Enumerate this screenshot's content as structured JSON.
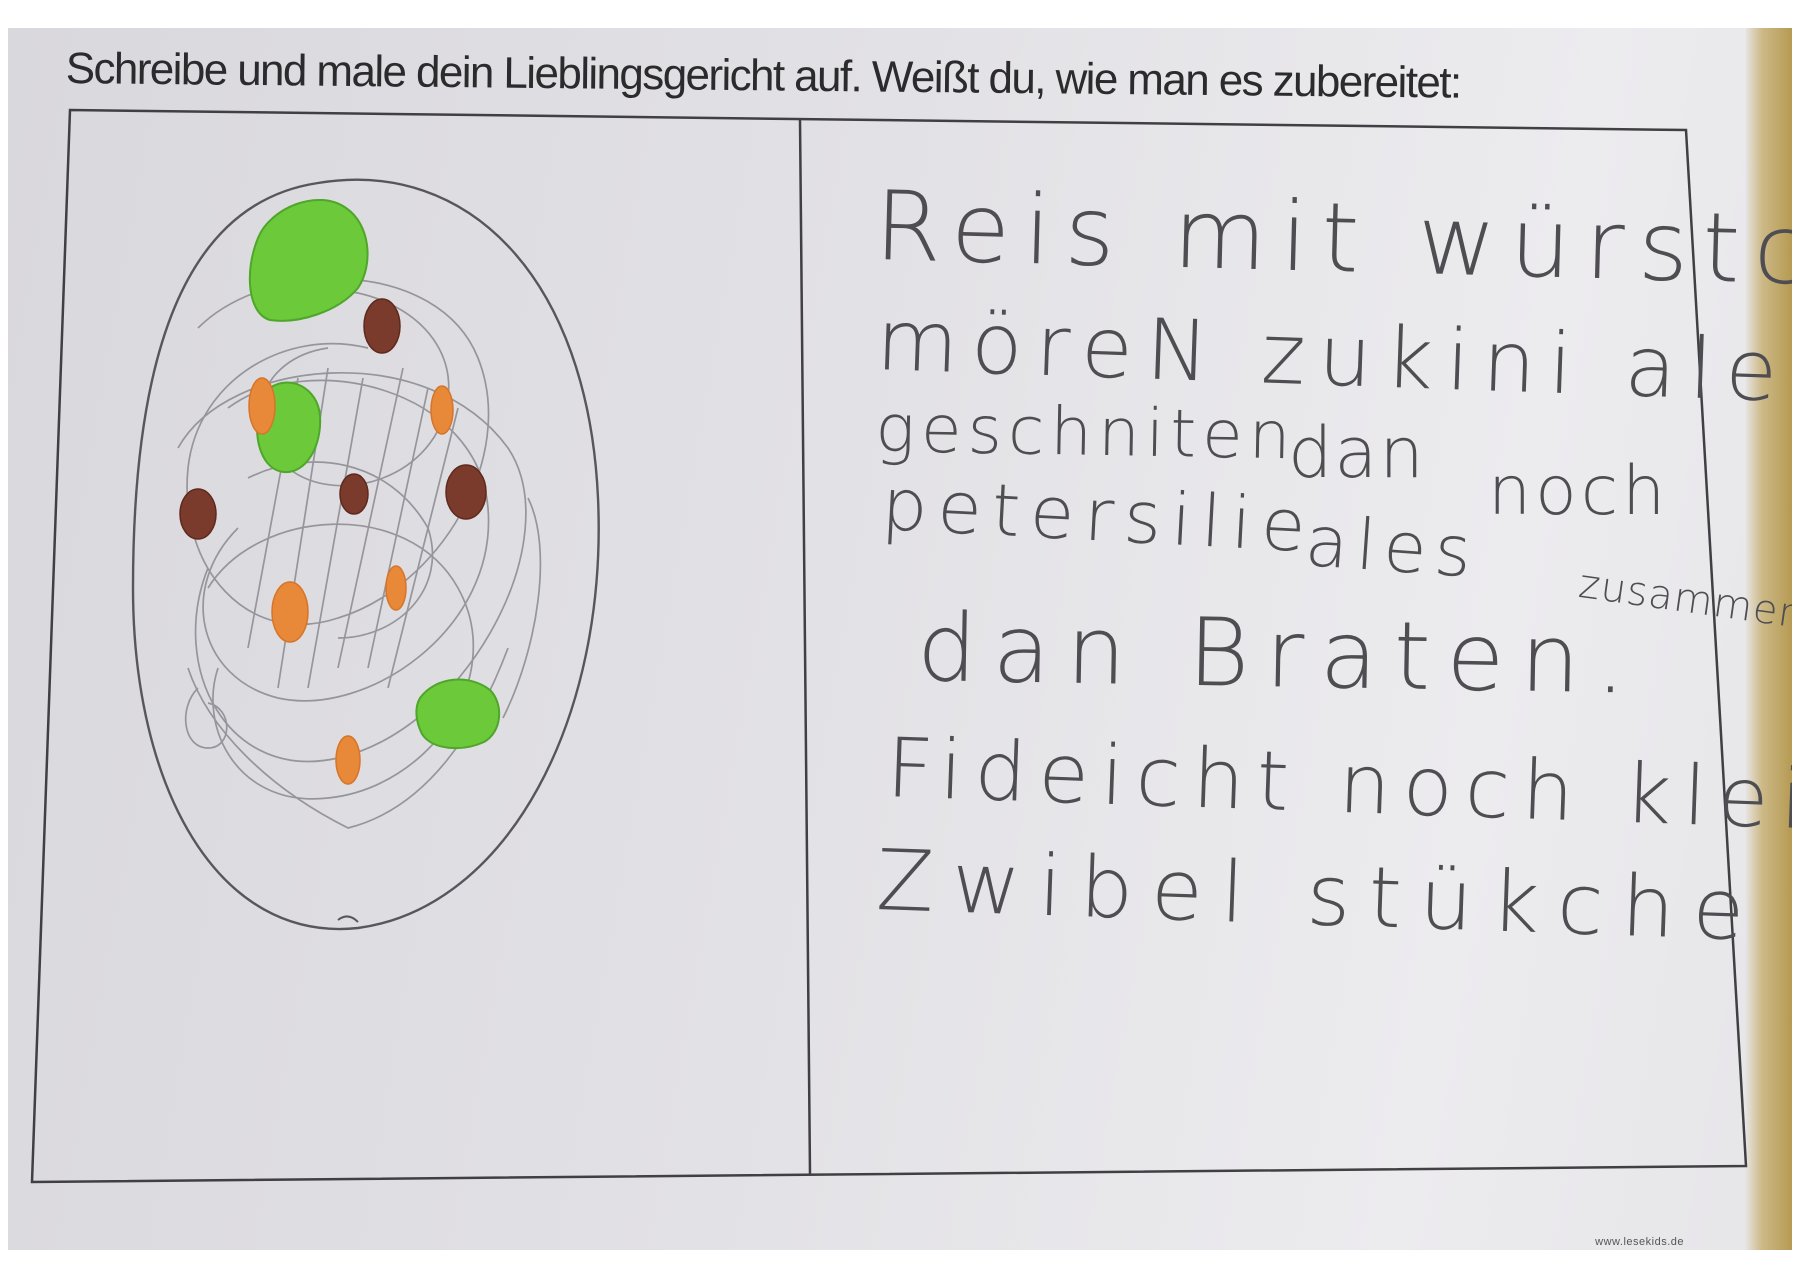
{
  "worksheet": {
    "instruction": "Schreibe und male dein Lieblingsgericht auf. Weißt du, wie man es zubereitet:",
    "drawing": {
      "subject": "plate-with-rice-and-vegetables",
      "colors": {
        "pencil": "#6f6f74",
        "green": "#6cc93a",
        "orange": "#e8893a",
        "brown": "#7a3b2c"
      }
    },
    "handwriting": {
      "lines": [
        "Reis mit würstchen",
        "möreN zukini ales",
        "geschniten",
        "dan",
        "petersilie",
        "ales",
        "noch",
        "zusammen",
        "dan Braten.",
        "Fideicht noch kleine",
        "Zwibel stükche"
      ]
    },
    "footer": "www.lesekids.de"
  }
}
